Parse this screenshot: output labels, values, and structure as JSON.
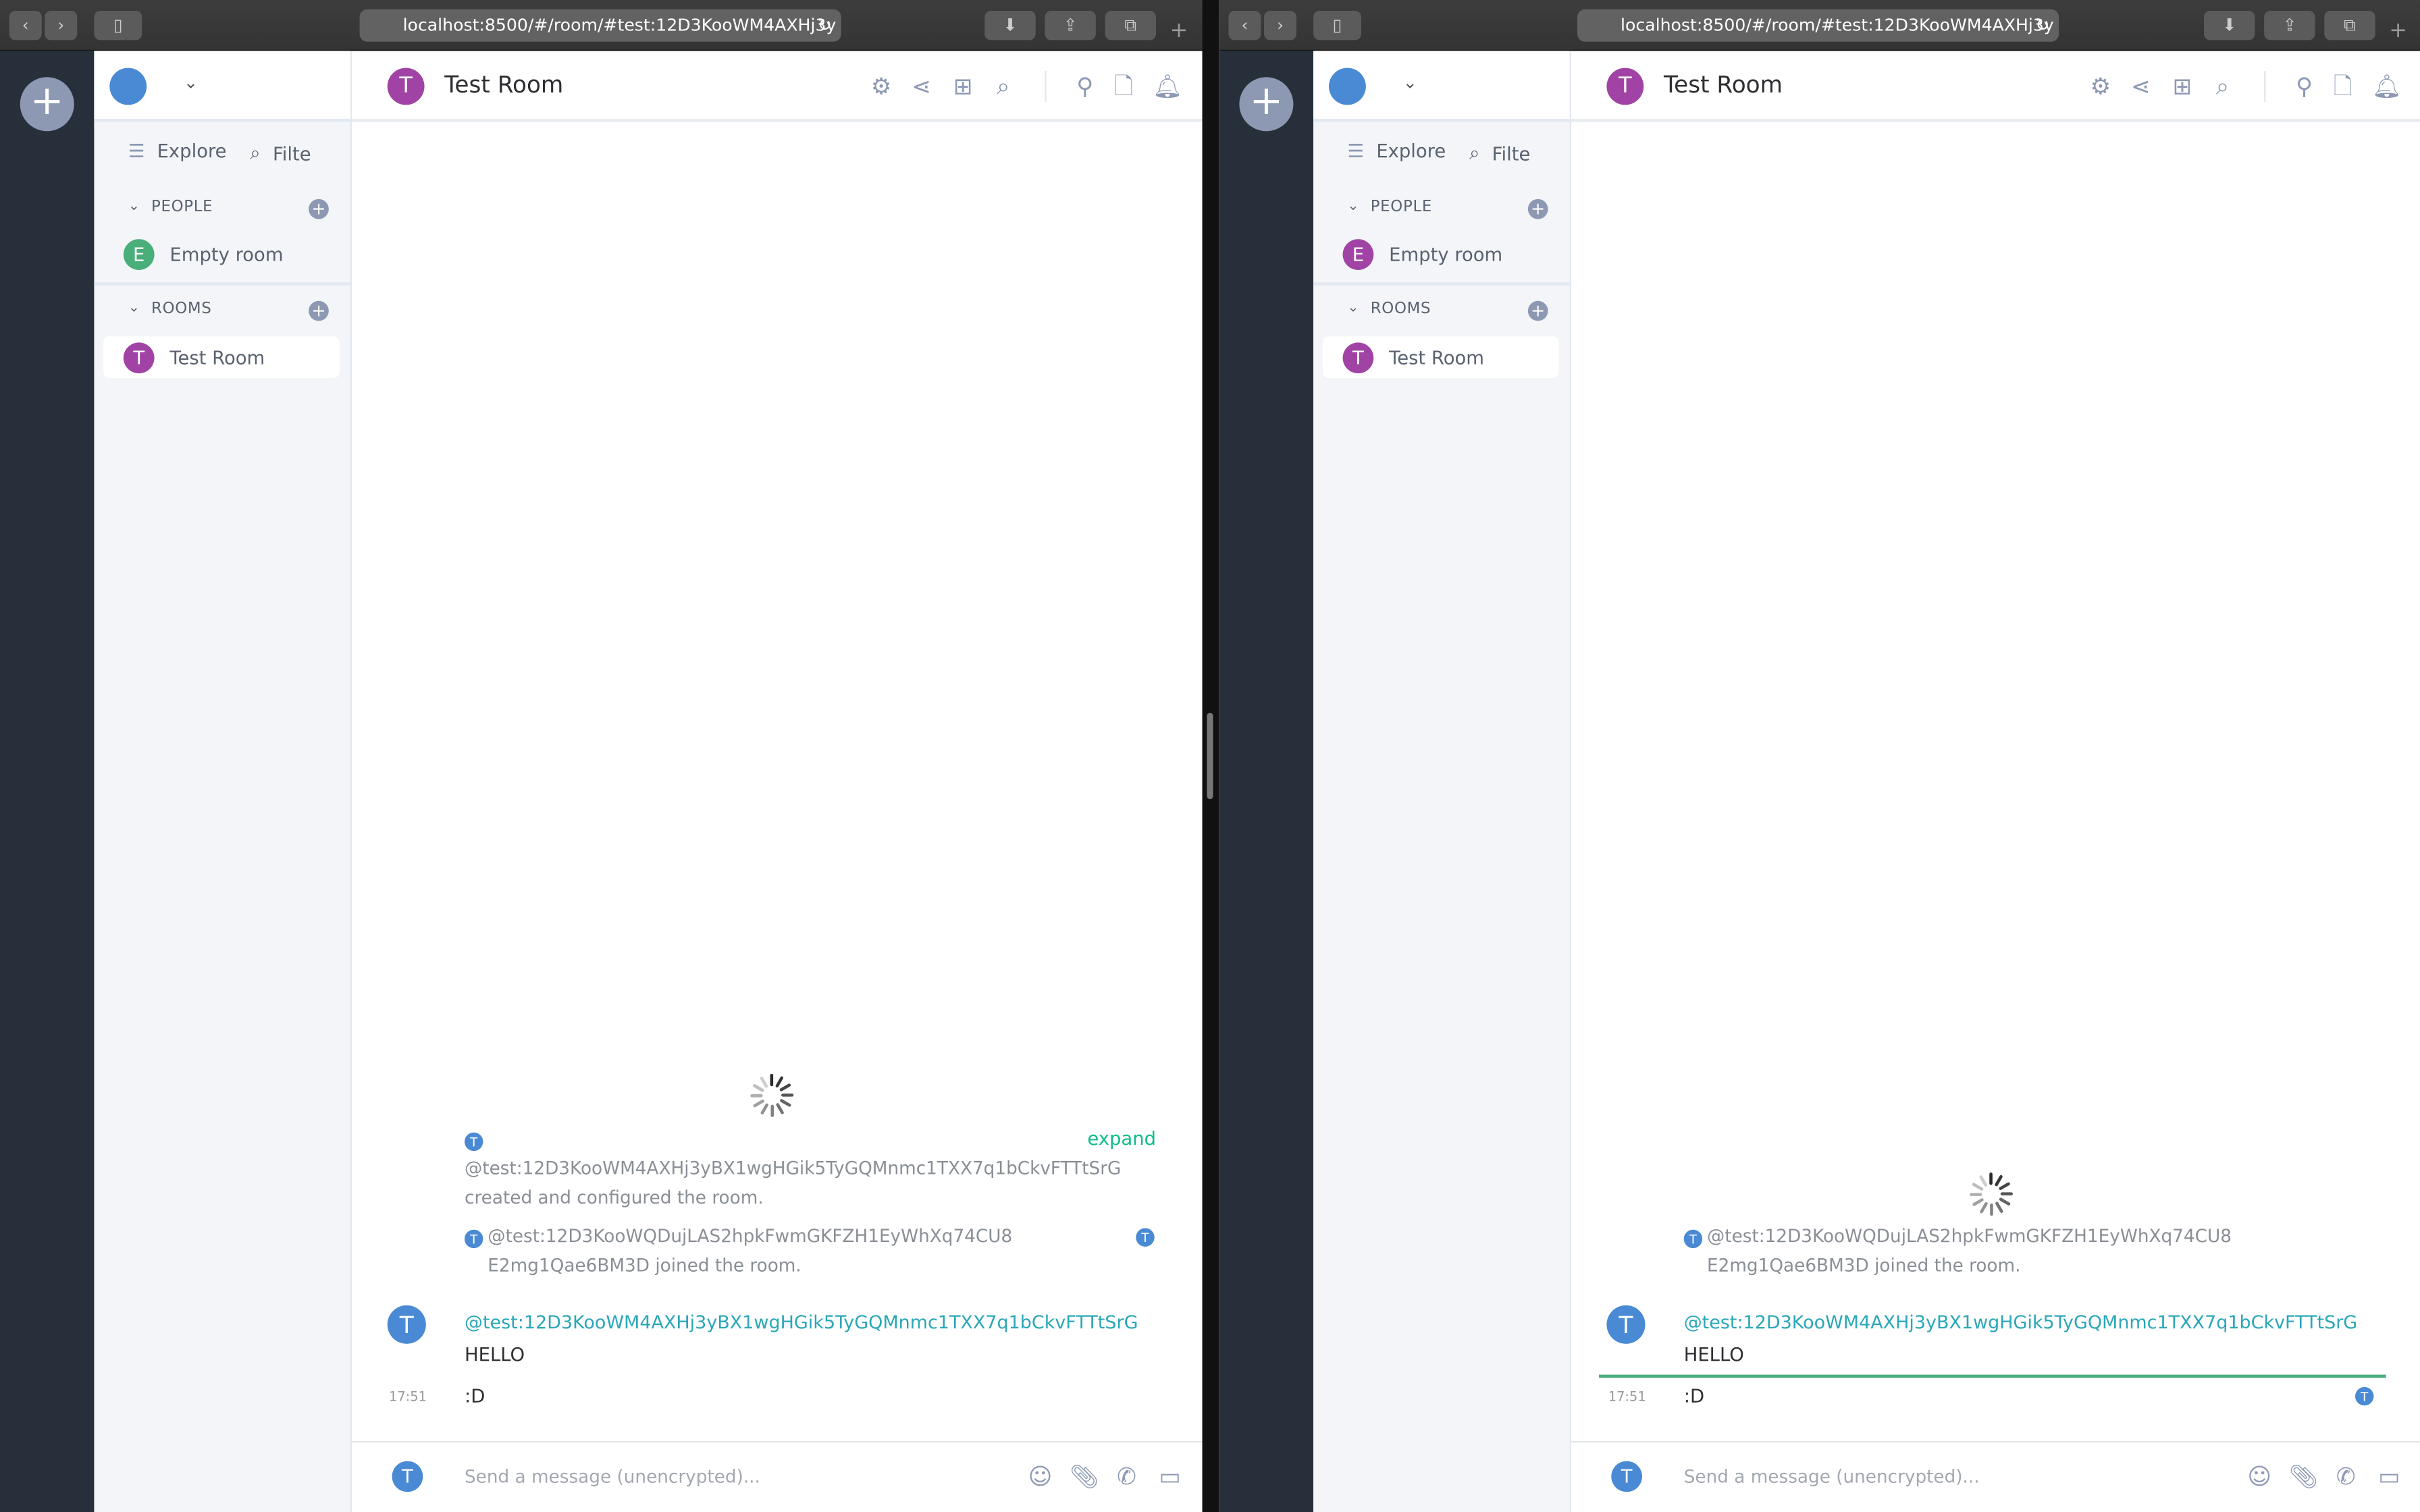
{
  "windows": [
    {
      "url": "localhost:8500/#/room/#test:12D3KooWM4AXHj3y",
      "sidebar": {
        "explore": "Explore",
        "filter": "Filte",
        "people_header": "PEOPLE",
        "people": [
          {
            "name": "Empty room",
            "initial": "E",
            "color": "#4aae7b"
          }
        ],
        "rooms_header": "ROOMS",
        "rooms": [
          {
            "name": "Test Room",
            "initial": "T",
            "color": "#a143a5"
          }
        ]
      },
      "room": {
        "title": "Test Room",
        "initial": "T",
        "color": "#a143a5"
      },
      "timeline": {
        "expand": "expand",
        "created_user": "@test:12D3KooWM4AXHj3yBX1wgHGik5TyGQMnmc1TXX7q1bCkvFTTtSrG",
        "created_text": "created and configured the room.",
        "joined_line1": "@test:12D3KooWQDujLAS2hpkFwmGKFZH1EyWhXq74CU8",
        "joined_line2": "E2mg1Qae6BM3D joined the room.",
        "sender": "@test:12D3KooWM4AXHj3yBX1wgHGik5TyGQMnmc1TXX7q1bCkvFTTtSrG",
        "messages": [
          "HELLO",
          ":D"
        ],
        "time": "17:51",
        "avatar_initial": "T"
      },
      "composer": {
        "placeholder": "Send a message (unencrypted)...",
        "avatar_initial": "T"
      }
    },
    {
      "url": "localhost:8500/#/room/#test:12D3KooWM4AXHj3y",
      "sidebar": {
        "explore": "Explore",
        "filter": "Filte",
        "people_header": "PEOPLE",
        "people": [
          {
            "name": "Empty room",
            "initial": "E",
            "color": "#a143a5"
          }
        ],
        "rooms_header": "ROOMS",
        "rooms": [
          {
            "name": "Test Room",
            "initial": "T",
            "color": "#a143a5"
          }
        ]
      },
      "room": {
        "title": "Test Room",
        "initial": "T",
        "color": "#a143a5"
      },
      "timeline": {
        "joined_line1": "@test:12D3KooWQDujLAS2hpkFwmGKFZH1EyWhXq74CU8",
        "joined_line2": "E2mg1Qae6BM3D joined the room.",
        "sender": "@test:12D3KooWM4AXHj3yBX1wgHGik5TyGQMnmc1TXX7q1bCkvFTTtSrG",
        "messages": [
          "HELLO",
          ":D"
        ],
        "time": "17:51",
        "avatar_initial": "T"
      },
      "composer": {
        "placeholder": "Send a message (unencrypted)...",
        "avatar_initial": "T"
      }
    }
  ],
  "colors": {
    "accent": "#0dbd8b",
    "sender": "#2aa7b8",
    "avatar_blue": "#4a8ad4",
    "rail": "#27303a",
    "read_marker": "#4aae7b"
  }
}
